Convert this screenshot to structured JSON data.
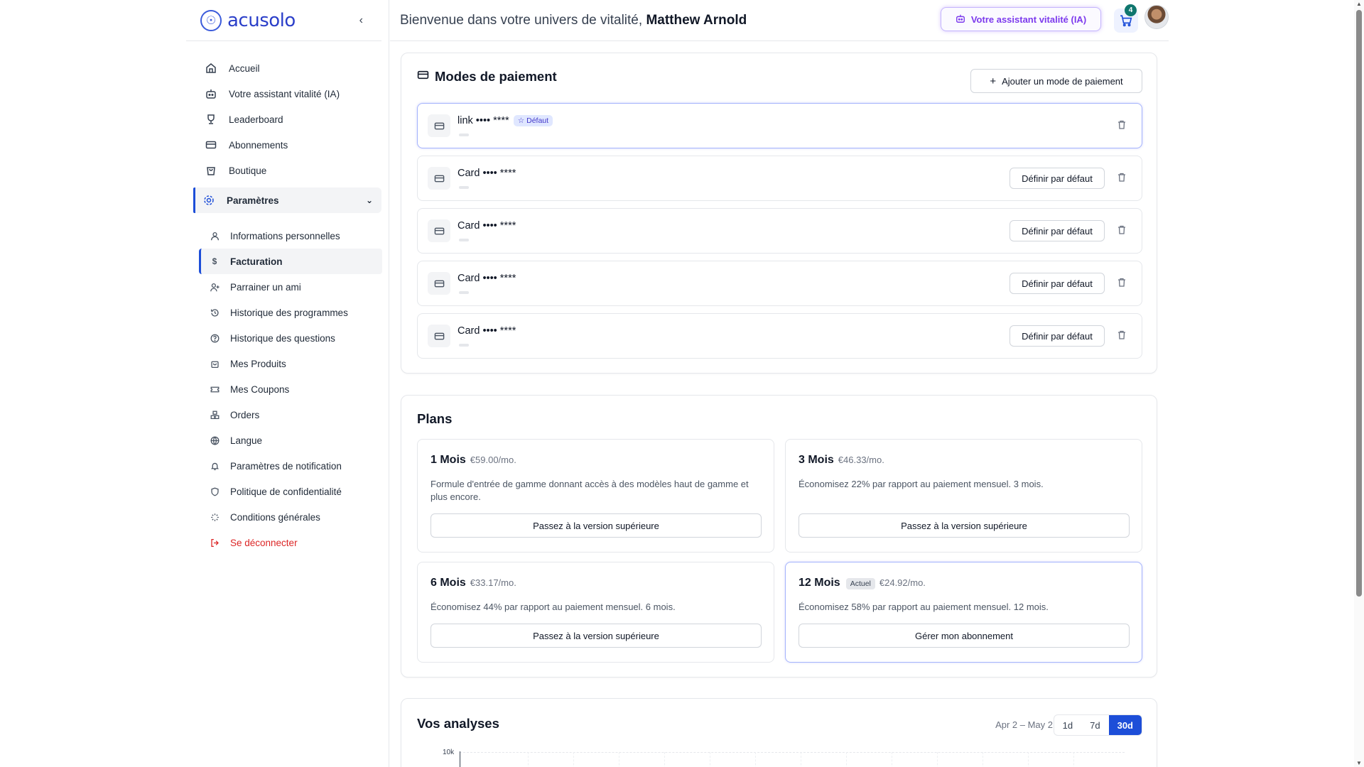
{
  "app": {
    "logo_text": "acusolo"
  },
  "sidebar": {
    "items": [
      {
        "label": "Accueil",
        "icon": "home-icon"
      },
      {
        "label": "Votre assistant vitalité (IA)",
        "icon": "bot-icon"
      },
      {
        "label": "Leaderboard",
        "icon": "trophy-icon"
      },
      {
        "label": "Abonnements",
        "icon": "credit-card-icon"
      },
      {
        "label": "Boutique",
        "icon": "shopping-bag-icon"
      }
    ],
    "settings_label": "Paramètres",
    "sub_items": [
      {
        "label": "Informations personnelles",
        "icon": "user-icon"
      },
      {
        "label": "Facturation",
        "icon": "dollar-icon"
      },
      {
        "label": "Parrainer un ami",
        "icon": "user-plus-icon"
      },
      {
        "label": "Historique des programmes",
        "icon": "history-icon"
      },
      {
        "label": "Historique des questions",
        "icon": "help-circle-icon"
      },
      {
        "label": "Mes Produits",
        "icon": "bag-icon"
      },
      {
        "label": "Mes Coupons",
        "icon": "ticket-icon"
      },
      {
        "label": "Orders",
        "icon": "boxes-icon"
      },
      {
        "label": "Langue",
        "icon": "globe-icon"
      },
      {
        "label": "Paramètres de notification",
        "icon": "bell-icon"
      },
      {
        "label": "Politique de confidentialité",
        "icon": "shield-icon"
      },
      {
        "label": "Conditions générales",
        "icon": "loader-icon"
      }
    ],
    "logout_label": "Se déconnecter"
  },
  "header": {
    "welcome_prefix": "Bienvenue dans votre univers de vitalité,",
    "user_name": "Matthew Arnold",
    "assistant_label": "Votre assistant vitalité (IA)",
    "cart_count": "4"
  },
  "payment": {
    "title": "Modes de paiement",
    "add_label": "Ajouter un mode de paiement",
    "default_badge": "Défaut",
    "set_default_label": "Définir par défaut",
    "methods": [
      {
        "label": "link •••• ****"
      },
      {
        "label": "Card •••• ****"
      },
      {
        "label": "Card •••• ****"
      },
      {
        "label": "Card •••• ****"
      },
      {
        "label": "Card •••• ****"
      }
    ]
  },
  "plans": {
    "title": "Plans",
    "current_badge": "Actuel",
    "items": [
      {
        "name": "1 Mois",
        "price": "€59.00/mo.",
        "desc": "Formule d'entrée de gamme donnant accès à des modèles haut de gamme et plus encore.",
        "button": "Passez à la version supérieure"
      },
      {
        "name": "3 Mois",
        "price": "€46.33/mo.",
        "desc": "Économisez 22% par rapport au paiement mensuel. 3 mois.",
        "button": "Passez à la version supérieure"
      },
      {
        "name": "6 Mois",
        "price": "€33.17/mo.",
        "desc": "Économisez 44% par rapport au paiement mensuel. 6 mois.",
        "button": "Passez à la version supérieure"
      },
      {
        "name": "12 Mois",
        "price": "€24.92/mo.",
        "desc": "Économisez 58% par rapport au paiement mensuel. 12 mois.",
        "button": "Gérer mon abonnement"
      }
    ]
  },
  "analytics": {
    "title": "Vos analyses",
    "range_label": "Apr 2 – May 2",
    "ranges": [
      "1d",
      "7d",
      "30d"
    ],
    "y_tick": "10k"
  },
  "colors": {
    "accent": "#1d4ed8",
    "assistant": "#7c3aed",
    "logout": "#dc2626"
  }
}
